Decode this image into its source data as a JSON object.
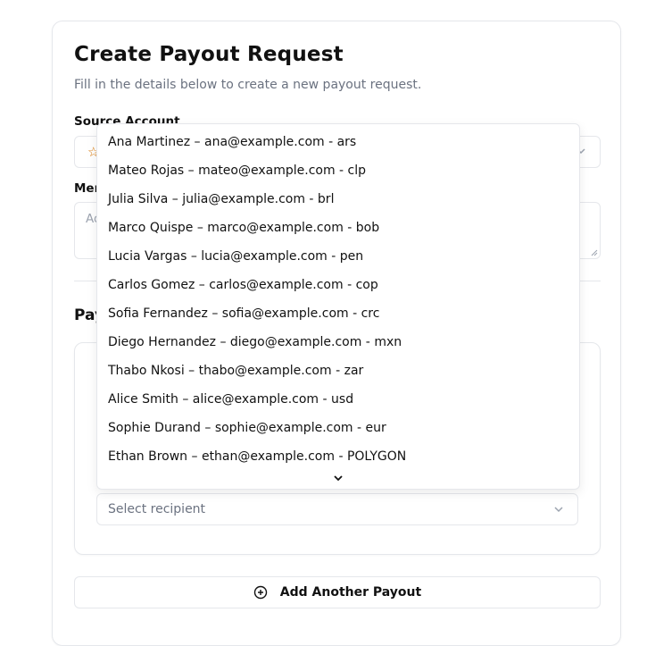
{
  "form": {
    "title": "Create Payout Request",
    "subtitle": "Fill in the details below to create a new payout request.",
    "source_account_label": "Source Account",
    "memo_label": "Memo",
    "memo_placeholder": "Ad",
    "payouts_section_title": "Payouts",
    "recipient_placeholder": "Select recipient",
    "add_payout_label": "Add Another Payout"
  },
  "recipient_dropdown": {
    "options": [
      "Ana Martinez – ana@example.com - ars",
      "Mateo Rojas – mateo@example.com - clp",
      "Julia Silva – julia@example.com - brl",
      "Marco Quispe – marco@example.com - bob",
      "Lucia Vargas – lucia@example.com - pen",
      "Carlos Gomez – carlos@example.com - cop",
      "Sofia Fernandez – sofia@example.com - crc",
      "Diego Hernandez – diego@example.com - mxn",
      "Thabo Nkosi – thabo@example.com - zar",
      "Alice Smith – alice@example.com - usd",
      "Sophie Durand – sophie@example.com - eur",
      "Ethan Brown – ethan@example.com - POLYGON"
    ]
  },
  "icons": {
    "source_account_icon": "star-icon",
    "select_chevron": "chevron-down-icon",
    "add_button_icon": "plus-circle-icon",
    "scroll_indicator": "chevron-down-icon"
  },
  "colors": {
    "border": "#e5e7eb",
    "muted_text": "#6b7280",
    "star_accent": "#d97706"
  }
}
